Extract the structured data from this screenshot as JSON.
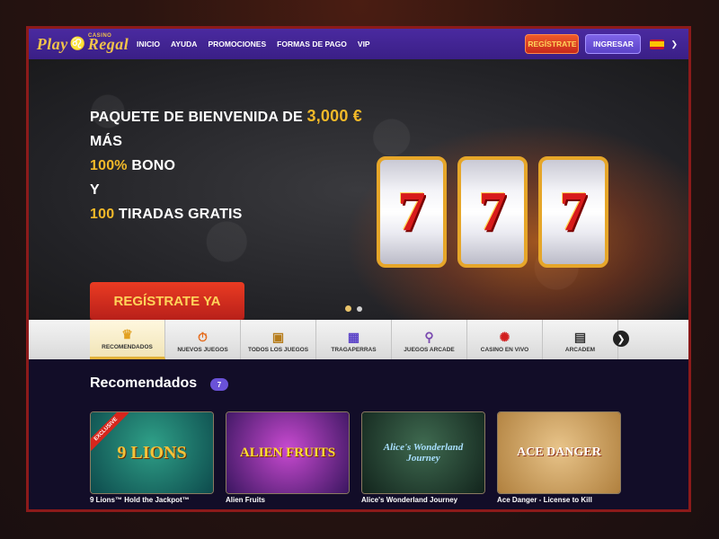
{
  "header": {
    "logo_main": "Play",
    "logo_second": "Regal",
    "logo_small": "CASINO",
    "nav": [
      "INICIO",
      "AYUDA",
      "PROMOCIONES",
      "FORMAS DE PAGO",
      "VIP"
    ],
    "register_label": "REGÍSTRATE",
    "login_label": "INGRESAR",
    "language_flag": "spain-flag-icon"
  },
  "hero": {
    "line1_prefix": "PAQUETE DE BIENVENIDA DE ",
    "line1_amount": "3,000 €",
    "line2": "MÁS",
    "line3_highlight": "100%",
    "line3_rest": " BONO",
    "line4": "Y",
    "line5_highlight": "100",
    "line5_rest": " TIRADAS GRATIS",
    "cta_label": "REGÍSTRATE YA",
    "reel_symbols": [
      "7",
      "7",
      "7"
    ],
    "carousel_active": 1,
    "carousel_total": 2
  },
  "categories": [
    {
      "label": "RECOMENDADOS",
      "icon": "crown-icon",
      "glyph": "♛",
      "active": true
    },
    {
      "label": "NUEVOS JUEGOS",
      "icon": "stopwatch-icon",
      "glyph": "⏱",
      "active": false
    },
    {
      "label": "TODOS LOS JUEGOS",
      "icon": "treasure-chest-icon",
      "glyph": "▣",
      "active": false
    },
    {
      "label": "TRAGAPERRAS",
      "icon": "slot-machine-icon",
      "glyph": "▦",
      "active": false
    },
    {
      "label": "JUEGOS ARCADE",
      "icon": "joystick-icon",
      "glyph": "⚲",
      "active": false
    },
    {
      "label": "CASINO EN VIVO",
      "icon": "roulette-chip-icon",
      "glyph": "✺",
      "active": false
    },
    {
      "label": "ARCADEM",
      "icon": "arcade-cabinet-icon",
      "glyph": "▤",
      "active": false
    }
  ],
  "recommended": {
    "title": "Recomendados",
    "count": "7",
    "games": [
      {
        "name": "9 Lions™ Hold the Jackpot™",
        "art_text": "9 LIONS",
        "exclusive_label": "EXCLUSIVE"
      },
      {
        "name": "Alien Fruits",
        "art_text": "ALIEN FRUITS"
      },
      {
        "name": "Alice's Wonderland Journey",
        "art_text": "Alice's Wonderland Journey"
      },
      {
        "name": "Ace Danger - License to Kill",
        "art_text": "ACE DANGER"
      }
    ]
  },
  "colors": {
    "nav_purple": "#3a1f86",
    "accent_gold": "#f2b929",
    "cta_red": "#d12a1e",
    "login_violet": "#6a52d8"
  }
}
